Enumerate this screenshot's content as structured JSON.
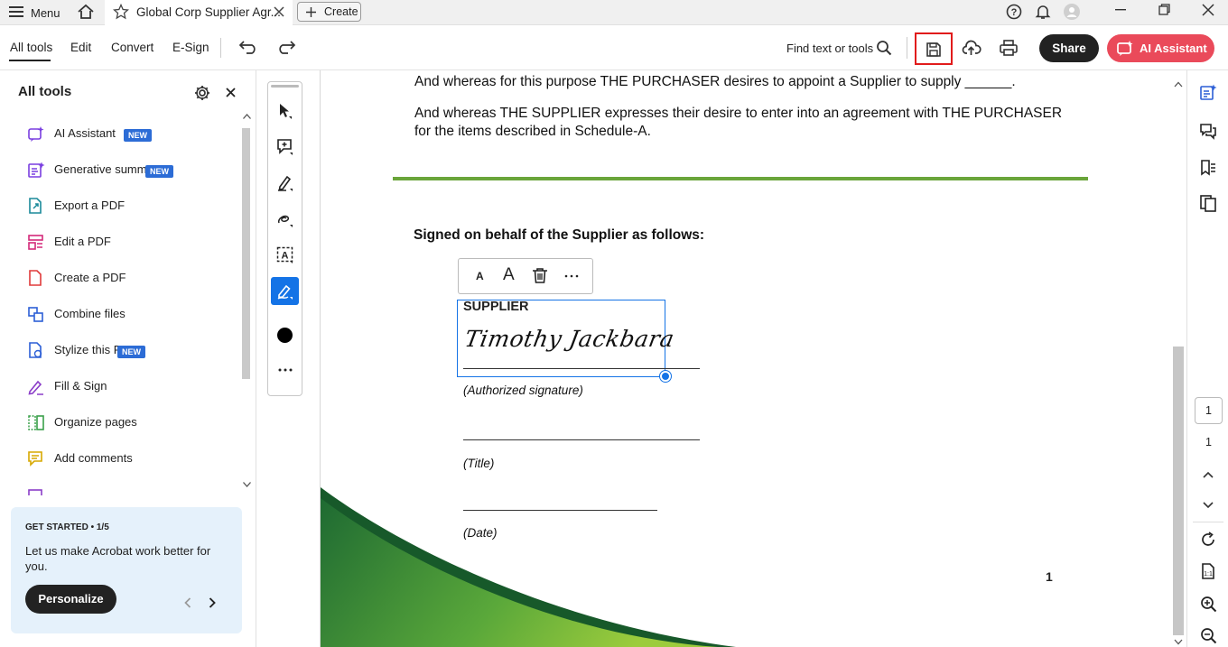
{
  "titlebar": {
    "menu_label": "Menu",
    "tab_title": "Global Corp Supplier Agr...",
    "create_label": "Create"
  },
  "toolbar": {
    "nav": [
      "All tools",
      "Edit",
      "Convert",
      "E-Sign"
    ],
    "find_label": "Find text or tools",
    "share_label": "Share",
    "ai_label": "AI Assistant"
  },
  "leftpanel": {
    "title": "All tools",
    "items": [
      {
        "label": "AI Assistant",
        "badge": "NEW",
        "color": "#7a3fe0"
      },
      {
        "label": "Generative summary",
        "badge": "NEW",
        "color": "#7a3fe0"
      },
      {
        "label": "Export a PDF",
        "badge": "",
        "color": "#1b8a9a"
      },
      {
        "label": "Edit a PDF",
        "badge": "",
        "color": "#d4297a"
      },
      {
        "label": "Create a PDF",
        "badge": "",
        "color": "#e03a3a"
      },
      {
        "label": "Combine files",
        "badge": "",
        "color": "#2c5fd6"
      },
      {
        "label": "Stylize this PDF",
        "badge": "NEW",
        "color": "#2c5fd6"
      },
      {
        "label": "Fill & Sign",
        "badge": "",
        "color": "#8b3ec8"
      },
      {
        "label": "Organize pages",
        "badge": "",
        "color": "#3aa04a"
      },
      {
        "label": "Add comments",
        "badge": "",
        "color": "#d7a800"
      }
    ],
    "promo": {
      "heading": "GET STARTED • 1/5",
      "body": "Let us make Acrobat work better for you.",
      "button": "Personalize"
    }
  },
  "document": {
    "para1": "And whereas for this purpose THE PURCHASER desires to appoint a Supplier to supply ______.",
    "para2_line1": "And whereas THE SUPPLIER expresses their desire to enter into an agreement with THE PURCHASER",
    "para2_line2": "for the items described in Schedule-A.",
    "signed_heading": "Signed on behalf of the Supplier as follows:",
    "supplier_label": "SUPPLIER",
    "signature": "Timothy Jackbara",
    "authorized_label": "(Authorized signature)",
    "title_label": "(Title)",
    "date_label": "(Date)",
    "page_number": "1"
  },
  "rightrail": {
    "page_input": "1",
    "page_total": "1"
  },
  "colors": {
    "accent_green": "#6aa53a",
    "highlight_red": "#e11b1b",
    "selection_blue": "#1473e6"
  }
}
